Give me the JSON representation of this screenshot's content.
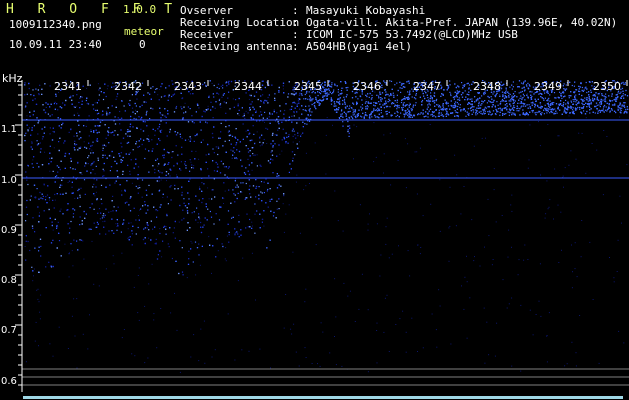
{
  "app": {
    "name": "H R O F F T",
    "version": "1.0.0"
  },
  "file": {
    "name": "1009112340.png",
    "datetime": "10.09.11 23:40"
  },
  "meteor": {
    "label": "meteor",
    "count": "0"
  },
  "info": [
    {
      "label": "Ovserver",
      "sep": ":",
      "value": "Masayuki Kobayashi"
    },
    {
      "label": "Receiving Location",
      "sep": ":",
      "value": "Ogata-vill. Akita-Pref. JAPAN (139.96E, 40.02N)"
    },
    {
      "label": "Receiver",
      "sep": ":",
      "value": "ICOM IC-575 53.7492(@LCD)MHz USB"
    },
    {
      "label": "Receiving antenna",
      "sep": ":",
      "value": "A504HB(yagi 4el)"
    }
  ],
  "chart_data": {
    "type": "heatmap",
    "ylabel": "kHz",
    "y_ticks": [
      "1.1",
      "1.0",
      "0.9",
      "0.8",
      "0.7",
      "0.6"
    ],
    "x_ticks": [
      "2341",
      "2342",
      "2343",
      "2344",
      "2345",
      "2346",
      "2347",
      "2348",
      "2349",
      "2350"
    ],
    "signal_color": "#2a4dff",
    "reference_line_color": "#3a5dff"
  }
}
